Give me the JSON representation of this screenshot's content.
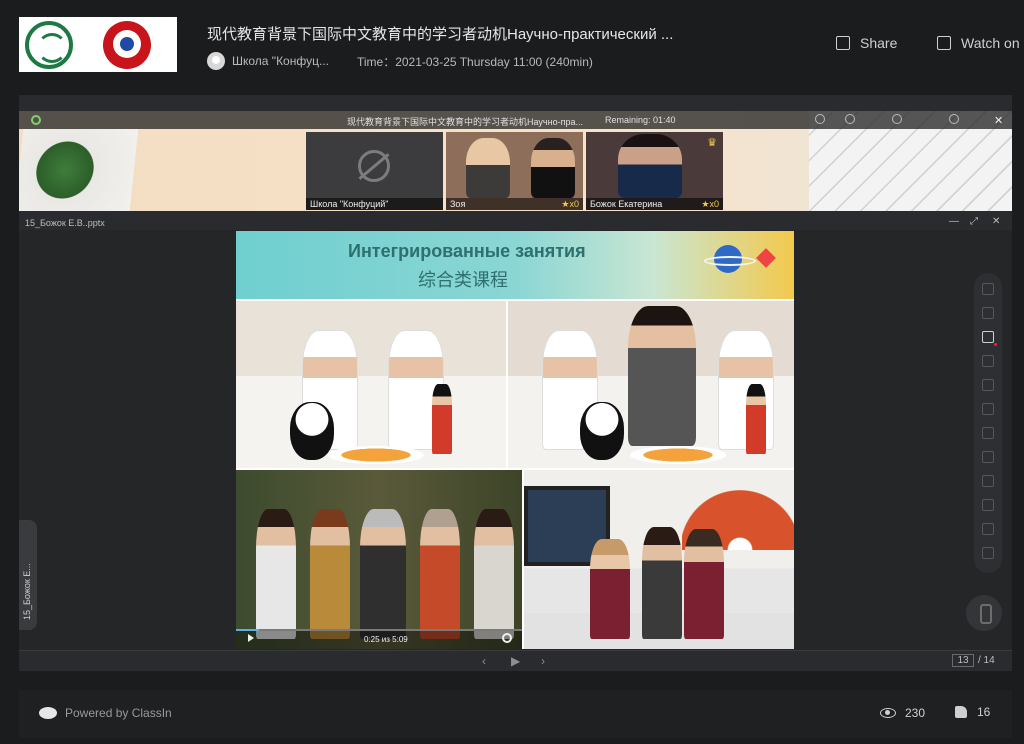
{
  "header": {
    "title": "现代教育背景下国际中文教育中的学习者动机Научно-практический ...",
    "organizer": "Школа \"Конфуц...",
    "time": "Time：2021-03-25 Thursday 11:00 (240min)",
    "share_label": "Share",
    "watch_label": "Watch on"
  },
  "video_strip": {
    "title": "现代教育背景下国际中文教育中的学习者动机Научно-пра...",
    "remaining": "Remaining: 01:40",
    "tiles": [
      {
        "name": "Школа \"Конфуций\"",
        "stars": "",
        "camera": "off"
      },
      {
        "name": "Зоя",
        "stars": "x0"
      },
      {
        "name": "Божок Екатерина",
        "stars": "x0",
        "host": true
      }
    ]
  },
  "document": {
    "file_name": "15_Божок Е.В..pptx",
    "side_tab": "15_Божок Е...",
    "slide": {
      "title_ru": "Интегрированные занятия",
      "title_cn": "综合类课程",
      "video_time": "0:25 из 5:09",
      "video_progress": 0.08
    },
    "page_current": "13",
    "page_total": "/ 14"
  },
  "footer": {
    "powered_by": "Powered by ClassIn",
    "views": "230",
    "likes": "16"
  },
  "colors": {
    "background": "#1b1c1e",
    "panel": "#2a2b2e",
    "slide_header": "#6fcfcf",
    "accent_star": "#f2c94c"
  }
}
